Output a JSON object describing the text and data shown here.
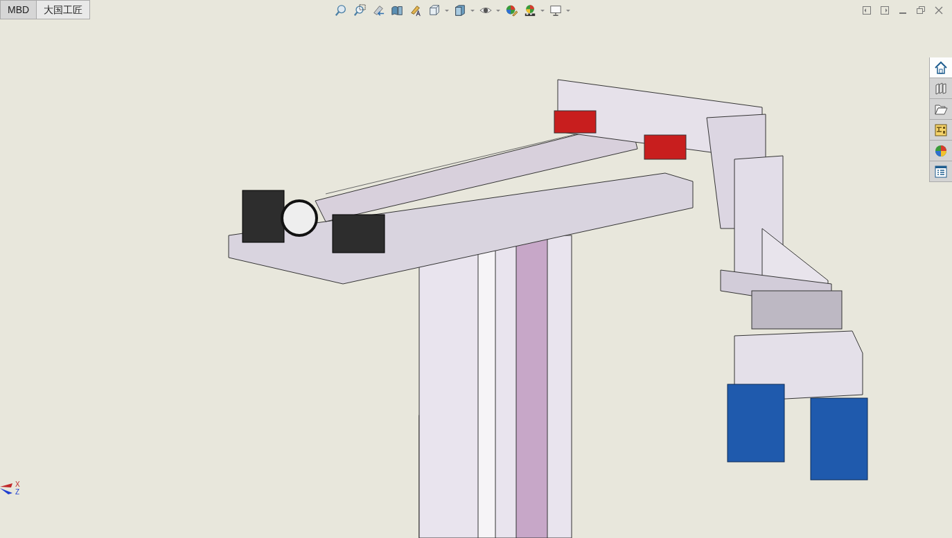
{
  "tabs": [
    {
      "label": "MBD",
      "selected": false
    },
    {
      "label": "大国工匠",
      "selected": true
    }
  ],
  "view_toolbar": [
    {
      "kind": "zoom-fit",
      "dropdown": false
    },
    {
      "kind": "zoom-area",
      "dropdown": false
    },
    {
      "kind": "previous-view",
      "dropdown": false
    },
    {
      "kind": "section-view",
      "dropdown": false
    },
    {
      "kind": "dynamic-annotation",
      "dropdown": false
    },
    {
      "kind": "view-orientation",
      "dropdown": true
    },
    {
      "kind": "display-style",
      "dropdown": true
    },
    {
      "kind": "hide-show",
      "dropdown": true
    },
    {
      "kind": "edit-appearance",
      "dropdown": false
    },
    {
      "kind": "apply-scene",
      "dropdown": true
    },
    {
      "kind": "view-settings",
      "dropdown": true
    }
  ],
  "window_controls": [
    {
      "kind": "dock-left"
    },
    {
      "kind": "dock-right"
    },
    {
      "kind": "minimize"
    },
    {
      "kind": "restore"
    },
    {
      "kind": "close"
    }
  ],
  "task_pane": [
    {
      "kind": "home",
      "selected": true
    },
    {
      "kind": "library",
      "selected": false
    },
    {
      "kind": "folder",
      "selected": false
    },
    {
      "kind": "palette",
      "selected": false
    },
    {
      "kind": "appearance",
      "selected": false
    },
    {
      "kind": "properties",
      "selected": false
    }
  ],
  "triad": {
    "axes": [
      "X",
      "Z"
    ]
  }
}
